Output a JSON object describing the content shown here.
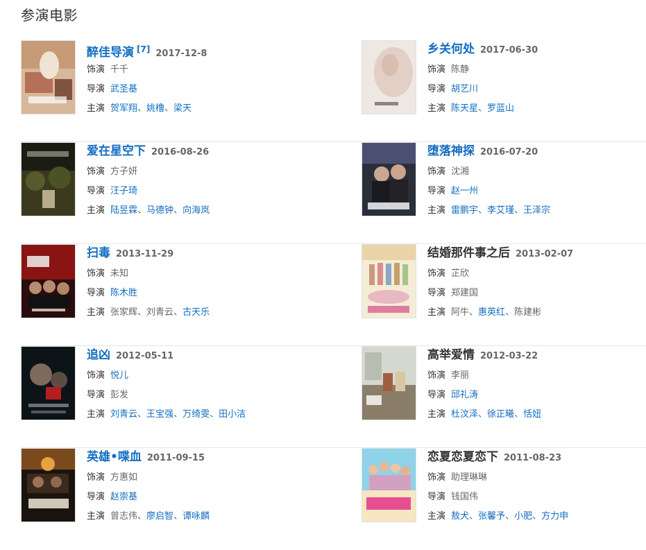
{
  "section_title": "参演电影",
  "labels": {
    "role": "饰演",
    "director": "导演",
    "starring": "主演",
    "separator": "、"
  },
  "movies": [
    {
      "title": "醉佳导演",
      "title_link": true,
      "ref": "[7]",
      "date": "2017-12-8",
      "role": {
        "text": "千千",
        "link": false
      },
      "director": {
        "text": "武圣基",
        "link": true
      },
      "starring": [
        {
          "text": "贺军翔",
          "link": true
        },
        {
          "text": "姚橹",
          "link": true
        },
        {
          "text": "梁天",
          "link": true
        }
      ],
      "poster_icon": "poster-zuijia-daoyan"
    },
    {
      "title": "乡关何处",
      "title_link": true,
      "date": "2017-06-30",
      "role": {
        "text": "陈静",
        "link": false
      },
      "director": {
        "text": "胡艺川",
        "link": true
      },
      "starring": [
        {
          "text": "陈天星",
          "link": true
        },
        {
          "text": "罗蓝山",
          "link": true
        }
      ],
      "poster_icon": "poster-xiangguan-hechu"
    },
    {
      "title": "爱在星空下",
      "title_link": true,
      "date": "2016-08-26",
      "role": {
        "text": "方子妍",
        "link": false
      },
      "director": {
        "text": "汪子琦",
        "link": true
      },
      "starring": [
        {
          "text": "陆昱霖",
          "link": true
        },
        {
          "text": "马德钟",
          "link": true
        },
        {
          "text": "向海岚",
          "link": true
        }
      ],
      "poster_icon": "poster-aizai-xingkongxia"
    },
    {
      "title": "堕落神探",
      "title_link": true,
      "date": "2016-07-20",
      "role": {
        "text": "沈湘",
        "link": false
      },
      "director": {
        "text": "赵一州",
        "link": true
      },
      "starring": [
        {
          "text": "雷鹏宇",
          "link": true
        },
        {
          "text": "李艾瑾",
          "link": true
        },
        {
          "text": "王泽宗",
          "link": true
        }
      ],
      "poster_icon": "poster-duoluo-shentan"
    },
    {
      "title": "扫毒",
      "title_link": true,
      "date": "2013-11-29",
      "role": {
        "text": "未知",
        "link": false
      },
      "director": {
        "text": "陈木胜",
        "link": true
      },
      "starring": [
        {
          "text": "张家辉",
          "link": false
        },
        {
          "text": "刘青云",
          "link": false
        },
        {
          "text": "古天乐",
          "link": true
        }
      ],
      "poster_icon": "poster-saodu"
    },
    {
      "title": "结婚那件事之后",
      "title_link": false,
      "date": "2013-02-07",
      "role": {
        "text": "芷欣",
        "link": false
      },
      "director": {
        "text": "郑建国",
        "link": false
      },
      "starring": [
        {
          "text": "阿牛",
          "link": false
        },
        {
          "text": "惠英红",
          "link": true
        },
        {
          "text": "陈建彬",
          "link": false
        }
      ],
      "poster_icon": "poster-jiehun-najianshi"
    },
    {
      "title": "追凶",
      "title_link": true,
      "date": "2012-05-11",
      "role": {
        "text": "悦儿",
        "link": true
      },
      "director": {
        "text": "彭发",
        "link": false
      },
      "starring": [
        {
          "text": "刘青云",
          "link": true
        },
        {
          "text": "王宝强",
          "link": true
        },
        {
          "text": "万绮雯",
          "link": true
        },
        {
          "text": "田小洁",
          "link": true
        }
      ],
      "poster_icon": "poster-zhuixiong"
    },
    {
      "title": "高举爱情",
      "title_link": false,
      "date": "2012-03-22",
      "role": {
        "text": "李丽",
        "link": false
      },
      "director": {
        "text": "邱礼涛",
        "link": true
      },
      "starring": [
        {
          "text": "杜汶泽",
          "link": true
        },
        {
          "text": "徐正曦",
          "link": true
        },
        {
          "text": "恬妞",
          "link": true
        }
      ],
      "poster_icon": "poster-gaoju-aiqing"
    },
    {
      "title": "英雄•喋血",
      "title_link": true,
      "date": "2011-09-15",
      "role": {
        "text": "方惠如",
        "link": false
      },
      "director": {
        "text": "赵崇基",
        "link": true
      },
      "starring": [
        {
          "text": "曾志伟",
          "link": false
        },
        {
          "text": "廖启智",
          "link": true
        },
        {
          "text": "谭咏麟",
          "link": true
        }
      ],
      "poster_icon": "poster-yingxiong-diexue"
    },
    {
      "title": "恋夏恋夏恋下",
      "title_link": false,
      "date": "2011-08-23",
      "role": {
        "text": "助理琳琳",
        "link": false
      },
      "director": {
        "text": "钱国伟",
        "link": false
      },
      "starring": [
        {
          "text": "敖犬",
          "link": true
        },
        {
          "text": "张馨予",
          "link": true
        },
        {
          "text": "小肥",
          "link": true
        },
        {
          "text": "方力申",
          "link": true
        }
      ],
      "poster_icon": "poster-lianxia"
    }
  ]
}
